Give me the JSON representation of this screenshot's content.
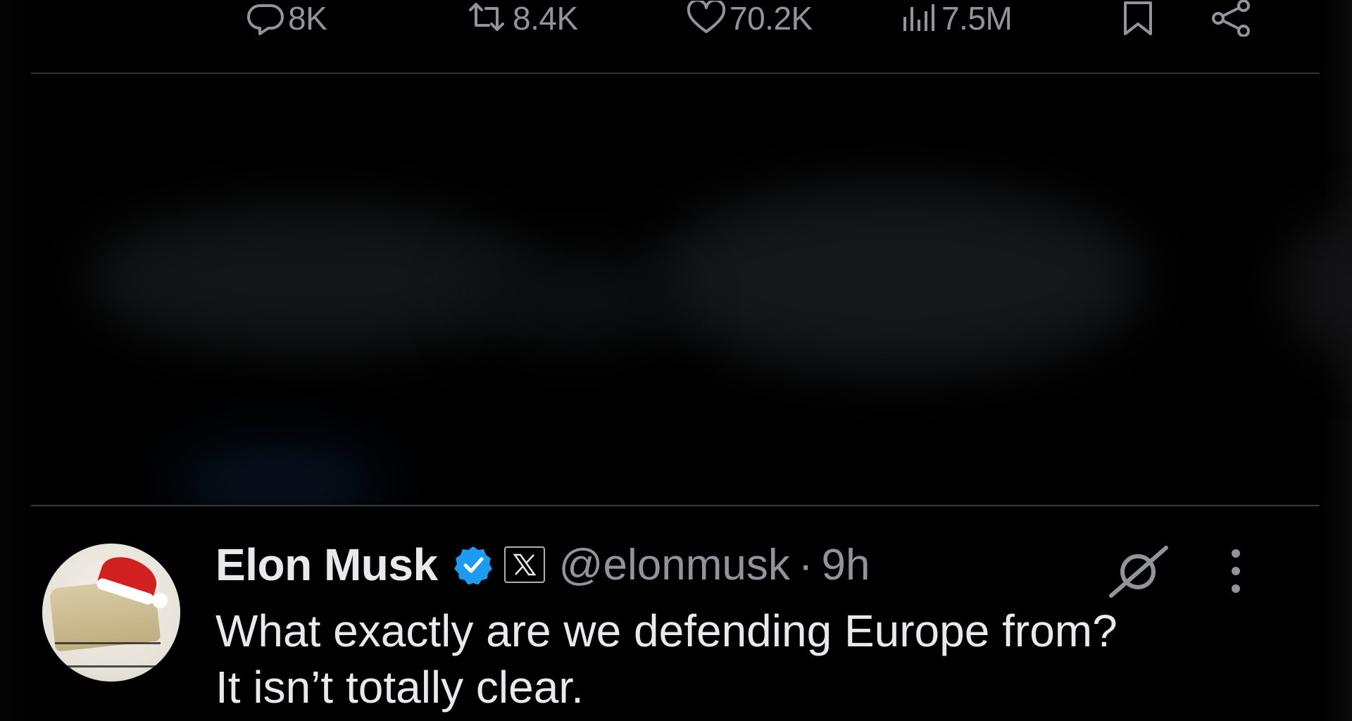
{
  "action_bar": {
    "reply": {
      "icon": "reply-bubble-icon",
      "count": "8K"
    },
    "repost": {
      "icon": "repost-icon",
      "count": "8.4K"
    },
    "like": {
      "icon": "heart-icon",
      "count": "70.2K"
    },
    "views": {
      "icon": "views-bar-chart-icon",
      "count": "7.5M"
    },
    "bookmark": {
      "icon": "bookmark-icon"
    },
    "share": {
      "icon": "share-icon"
    }
  },
  "tweet": {
    "display_name": "Elon Musk",
    "handle": "@elonmusk",
    "separator": "·",
    "timestamp": "9h",
    "verified_icon": "verified-badge-icon",
    "affiliate_icon": "x-logo-icon",
    "text_line_1": "What exactly are we defending Europe from?",
    "text_line_2": "It isn’t totally clear."
  },
  "colors": {
    "background": "#000000",
    "text_primary": "#e7e9ea",
    "text_secondary": "#8f959b",
    "divider": "#2f3336",
    "verified_blue": "#1d9bf0",
    "santa_red": "#d21f1f"
  }
}
